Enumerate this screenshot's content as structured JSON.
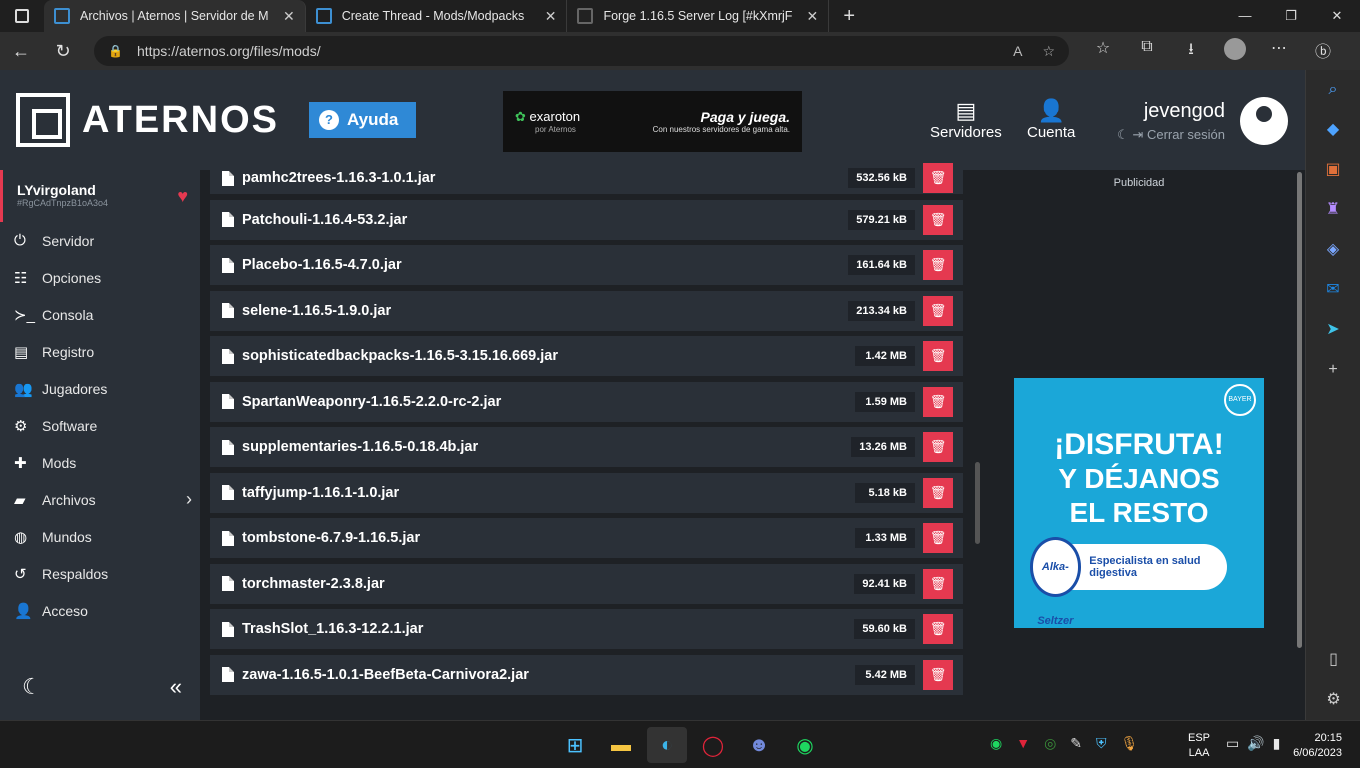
{
  "browser": {
    "tabs": [
      {
        "title": "Archivos | Aternos | Servidor de M",
        "active": true
      },
      {
        "title": "Create Thread - Mods/Modpacks",
        "active": false
      },
      {
        "title": "Forge 1.16.5 Server Log [#kXmrjF",
        "active": false
      }
    ],
    "url": "https://aternos.org/files/mods/"
  },
  "header": {
    "logo_text": "ATERNOS",
    "help_label": "Ayuda",
    "ad": {
      "brand": "exaroton",
      "brand_sub": "por Aternos",
      "slogan": "Paga y juega.",
      "slogan_sub": "Con nuestros servidores de gama alta."
    },
    "servers_label": "Servidores",
    "account_label": "Cuenta",
    "username": "jevengod",
    "logout_label": "Cerrar sesión"
  },
  "sidebar": {
    "server_name": "LYvirgoland",
    "server_id": "#RgCAdTnpzB1oA3o4",
    "items": [
      {
        "label": "Servidor",
        "icon": "power-icon"
      },
      {
        "label": "Opciones",
        "icon": "sliders-icon"
      },
      {
        "label": "Consola",
        "icon": "terminal-icon"
      },
      {
        "label": "Registro",
        "icon": "document-icon"
      },
      {
        "label": "Jugadores",
        "icon": "users-icon"
      },
      {
        "label": "Software",
        "icon": "gears-icon"
      },
      {
        "label": "Mods",
        "icon": "puzzle-icon"
      },
      {
        "label": "Archivos",
        "icon": "folder-icon"
      },
      {
        "label": "Mundos",
        "icon": "globe-icon"
      },
      {
        "label": "Respaldos",
        "icon": "history-icon"
      },
      {
        "label": "Acceso",
        "icon": "user-lock-icon"
      }
    ]
  },
  "files": [
    {
      "name": "pamhc2trees-1.16.3-1.0.1.jar",
      "size": "532.56 kB"
    },
    {
      "name": "Patchouli-1.16.4-53.2.jar",
      "size": "579.21 kB"
    },
    {
      "name": "Placebo-1.16.5-4.7.0.jar",
      "size": "161.64 kB"
    },
    {
      "name": "selene-1.16.5-1.9.0.jar",
      "size": "213.34 kB"
    },
    {
      "name": "sophisticatedbackpacks-1.16.5-3.15.16.669.jar",
      "size": "1.42 MB"
    },
    {
      "name": "SpartanWeaponry-1.16.5-2.2.0-rc-2.jar",
      "size": "1.59 MB"
    },
    {
      "name": "supplementaries-1.16.5-0.18.4b.jar",
      "size": "13.26 MB"
    },
    {
      "name": "taffyjump-1.16.1-1.0.jar",
      "size": "5.18 kB"
    },
    {
      "name": "tombstone-6.7.9-1.16.5.jar",
      "size": "1.33 MB"
    },
    {
      "name": "torchmaster-2.3.8.jar",
      "size": "92.41 kB"
    },
    {
      "name": "TrashSlot_1.16.3-12.2.1.jar",
      "size": "59.60 kB"
    },
    {
      "name": "zawa-1.16.5-1.0.1-BeefBeta-Carnivora2.jar",
      "size": "5.42 MB"
    }
  ],
  "right_ad": {
    "label": "Publicidad",
    "line1": "¡DISFRUTA!",
    "line2": "Y DÉJANOS",
    "line3": "EL RESTO",
    "brand": "Alka-Seltzer",
    "tagline": "Especialista en salud digestiva",
    "logo": "BAYER"
  },
  "taskbar": {
    "lang": "ESP",
    "lang_sub": "LAA",
    "time": "20:15",
    "date": "6/06/2023"
  },
  "colors": {
    "accent": "#e53950",
    "brand_blue": "#2f89d6",
    "panel": "#2a3038"
  }
}
